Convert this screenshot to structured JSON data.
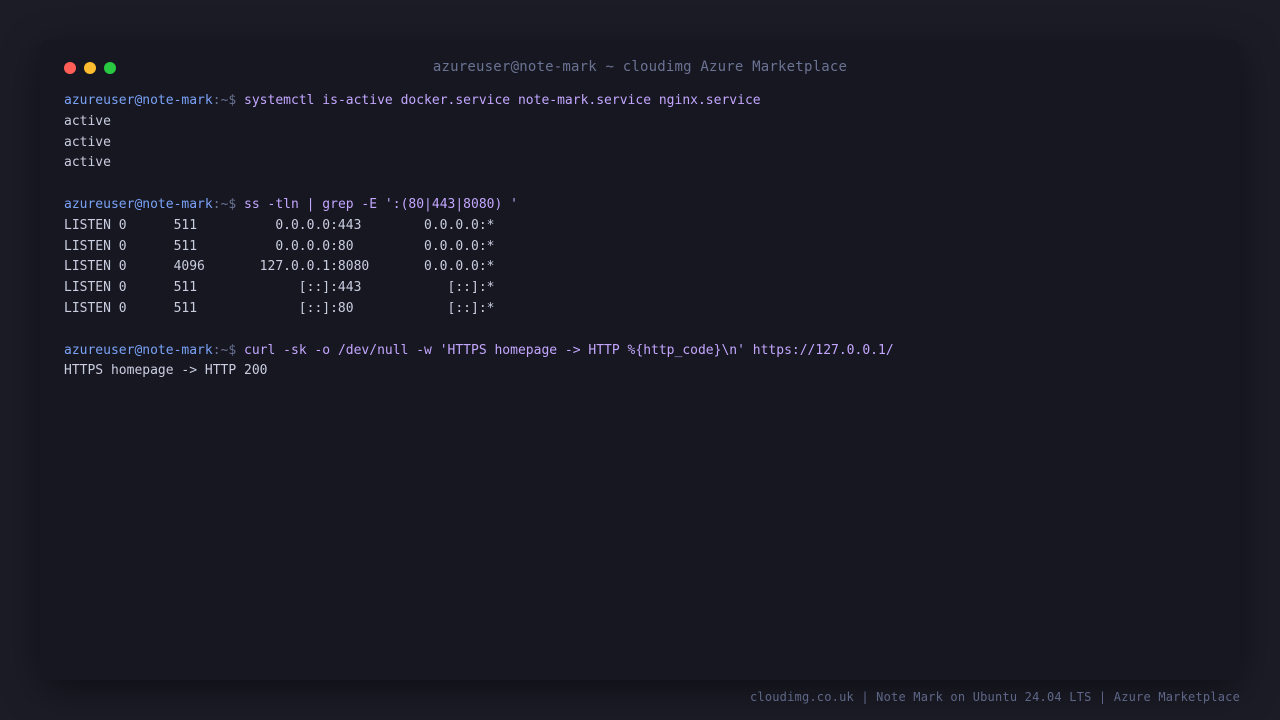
{
  "window": {
    "title": "azureuser@note-mark ~ cloudimg Azure Marketplace"
  },
  "prompt": {
    "user_host": "azureuser@note-mark",
    "path_sigil": ":~$ "
  },
  "session": {
    "cmd1": {
      "command": "systemctl is-active docker.service note-mark.service nginx.service",
      "output": [
        "active",
        "active",
        "active"
      ]
    },
    "cmd2": {
      "command": "ss -tln | grep -E ':(80|443|8080) '",
      "output": [
        "LISTEN 0      511          0.0.0.0:443        0.0.0.0:*",
        "LISTEN 0      511          0.0.0.0:80         0.0.0.0:*",
        "LISTEN 0      4096       127.0.0.1:8080       0.0.0.0:*",
        "LISTEN 0      511             [::]:443           [::]:*",
        "LISTEN 0      511             [::]:80            [::]:*"
      ]
    },
    "cmd3": {
      "command": "curl -sk -o /dev/null -w 'HTTPS homepage -> HTTP %{http_code}\\n' https://127.0.0.1/",
      "output": [
        "HTTPS homepage -> HTTP 200"
      ]
    }
  },
  "footer": {
    "text": "cloudimg.co.uk | Note Mark on Ubuntu 24.04 LTS | Azure Marketplace"
  },
  "colors": {
    "background": "#1b1c26",
    "terminal": "#161720",
    "prompt_user": "#7aa2f7",
    "command": "#c3a6ff",
    "output": "#c9cde0",
    "close": "#ff5f57",
    "minimize": "#febc2e",
    "maximize": "#28c840"
  }
}
